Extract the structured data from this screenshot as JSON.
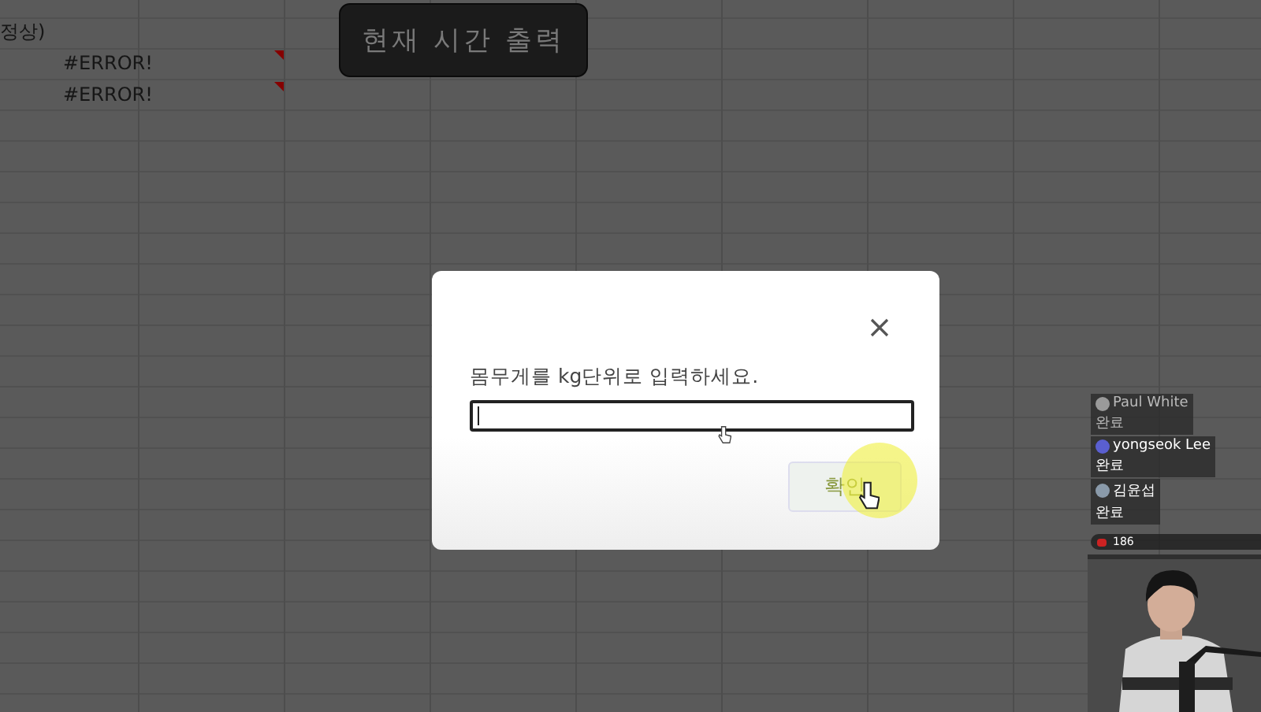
{
  "sheet": {
    "cells": [
      {
        "text": "정상)",
        "note": false
      },
      {
        "text": "#ERROR!",
        "note": true
      },
      {
        "text": "#ERROR!",
        "note": true
      }
    ],
    "button": "현재 시간 출력"
  },
  "dialog": {
    "message": "몸무게를 kg단위로 입력하세요.",
    "ok_button": "확인"
  },
  "chat": {
    "messages": [
      {
        "name": "Paul White",
        "text": "완료",
        "color": "#9a9a9a",
        "faded": true
      },
      {
        "name": "yongseok Lee",
        "text": "완료",
        "color": "#5a5fd0",
        "faded": false
      },
      {
        "name": "김윤섭",
        "text": "완료",
        "color": "#8a9aaa",
        "faded": false
      }
    ],
    "viewers": "186"
  }
}
